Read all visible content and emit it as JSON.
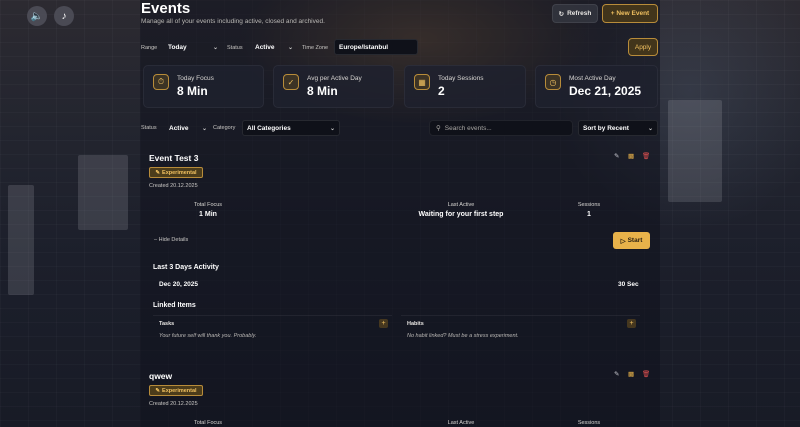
{
  "page": {
    "title": "Events",
    "subtitle": "Manage all of your events including active, closed and archived."
  },
  "corner_buttons": {
    "sound_icon": "speaker-icon",
    "music_icon": "music-note-icon"
  },
  "header_actions": {
    "refresh_label": "Refresh",
    "new_event_label": "+ New Event"
  },
  "filters": {
    "range_label": "Range",
    "range_value": "Today",
    "status_label": "Status",
    "status_value": "Active",
    "timezone_label": "Time Zone",
    "timezone_value": "Europe/Istanbul",
    "apply_label": "Apply"
  },
  "stats": [
    {
      "label": "Today Focus",
      "value": "8 Min",
      "icon": "timer-icon"
    },
    {
      "label": "Avg per Active Day",
      "value": "8 Min",
      "icon": "check-circle-icon"
    },
    {
      "label": "Today Sessions",
      "value": "2",
      "icon": "calendar-icon"
    },
    {
      "label": "Most Active Day",
      "value": "Dec 21, 2025",
      "icon": "clock-icon"
    }
  ],
  "list_filters": {
    "status_label": "Status",
    "status_value": "Active",
    "category_label": "Category",
    "category_value": "All Categories",
    "search_placeholder": "Search events...",
    "sort_value": "Sort by Recent"
  },
  "events": [
    {
      "name": "Event Test 3",
      "tag": "Experimental",
      "created": "Created 20.12.2025",
      "total_focus_label": "Total Focus",
      "total_focus": "1 Min",
      "last_active_label": "Last Active",
      "last_active": "Waiting for your first step",
      "sessions_label": "Sessions",
      "sessions": "1",
      "hide_details": "Hide Details",
      "start_label": "Start",
      "activity_title": "Last 3 Days Activity",
      "activity": [
        {
          "date": "Dec 20, 2025",
          "duration": "30 Sec"
        }
      ],
      "linked_title": "Linked Items",
      "tasks_label": "Tasks",
      "tasks_empty": "Your future self will thank you. Probably.",
      "habits_label": "Habits",
      "habits_empty": "No habit linked? Must be a stress experiment."
    },
    {
      "name": "qwew",
      "tag": "Experimental",
      "created": "Created 20.12.2025",
      "total_focus_label": "Total Focus",
      "last_active_label": "Last Active",
      "sessions_label": "Sessions"
    }
  ],
  "colors": {
    "accent": "#e8b24a",
    "danger": "#e05050",
    "edit": "#c8c8d0"
  }
}
